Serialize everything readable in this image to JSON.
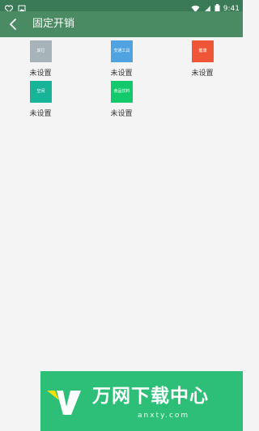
{
  "status_bar": {
    "time": "9:41"
  },
  "header": {
    "title": "固定开销"
  },
  "categories": [
    {
      "icon_label": "其它",
      "status": "未设置",
      "color": "#a6b3b8"
    },
    {
      "icon_label": "交通工具",
      "status": "未设置",
      "color": "#4fa3e0"
    },
    {
      "icon_label": "健康",
      "status": "未设置",
      "color": "#ef5536"
    },
    {
      "icon_label": "空闲",
      "status": "未设置",
      "color": "#17b49a"
    },
    {
      "icon_label": "食品饮料",
      "status": "未设置",
      "color": "#14c96b"
    }
  ],
  "watermark": {
    "brand": "万网下载中心",
    "domain": "anxty.com"
  }
}
